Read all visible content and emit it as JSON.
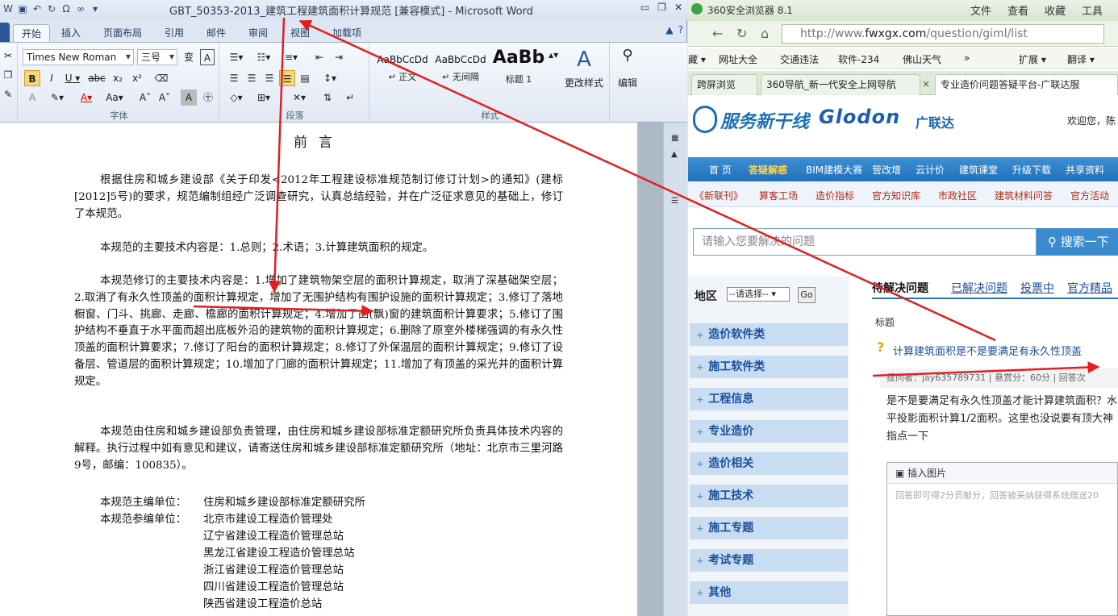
{
  "word": {
    "title": "GBT_50353-2013_建筑工程建筑面积计算规范 [兼容模式] - Microsoft Word",
    "qat_icons": [
      "word-icon",
      "save-icon",
      "undo-icon",
      "redo-icon",
      "symbol-icon",
      "customize-icon"
    ],
    "qat_omega": "Ω",
    "qat_infinity": "∞",
    "tabs": [
      "开始",
      "插入",
      "页面布局",
      "引用",
      "邮件",
      "审阅",
      "视图",
      "加载项"
    ],
    "font_name": "Times New Roman",
    "font_size": "三号",
    "styles": [
      {
        "sample": "AaBbCcDd",
        "name": "↵ 正文"
      },
      {
        "sample": "AaBbCcDd",
        "name": "↵ 无间隔"
      },
      {
        "sample": "AaBb",
        "name": "标题 1"
      }
    ],
    "change_styles": "更改样式",
    "edit": "编辑",
    "groups": [
      "字体",
      "段落",
      "样式"
    ],
    "doc": {
      "heading": "前言",
      "p1": "根据住房和城乡建设部《关于印发<2012年工程建设标准规范制订修订计划>的通知》(建标[2012]5号)的要求，规范编制组经广泛调查研究，认真总结经验，并在广泛征求意见的基础上，修订了本规范。",
      "p2": "本规范的主要技术内容是：1.总则；2.术语；3.计算建筑面积的规定。",
      "p3": "本规范修订的主要技术内容是：1.增加了建筑物架空层的面积计算规定，取消了深基础架空层；2.取消了有永久性顶盖的面积计算规定，增加了无围护结构有围护设施的面积计算规定；3.修订了落地橱窗、门斗、挑廊、走廊、檐廊的面积计算规定；4.增加了凸(飘)窗的建筑面积计算要求；5.修订了围护结构不垂直于水平面而超出底板外沿的建筑物的面积计算规定；6.删除了原室外楼梯强调的有永久性顶盖的面积计算要求；7.修订了阳台的面积计算规定；8.修订了外保温层的面积计算规定；9.修订了设备层、管道层的面积计算规定；10.增加了门廊的面积计算规定；11.增加了有顶盖的采光井的面积计算规定。",
      "p4": "本规范由住房和城乡建设部负责管理，由住房和城乡建设部标准定额研究所负责具体技术内容的解释。执行过程中如有意见和建议，请寄送住房和城乡建设部标准定额研究所（地址：北京市三里河路9号，邮编：100835）。",
      "chief_label": "本规范主编单位：",
      "chief": "住房和城乡建设部标准定额研究所",
      "part_label": "本规范参编单位：",
      "participants": [
        "北京市建设工程造价管理处",
        "辽宁省建设工程造价管理总站",
        "黑龙江省建设工程造价管理总站",
        "浙江省建设工程造价管理总站",
        "四川省建设工程造价管理总站",
        "陕西省建设工程造价总站"
      ]
    }
  },
  "browser": {
    "name": "360安全浏览器 8.1",
    "menu": [
      "文件",
      "查看",
      "收藏",
      "工具"
    ],
    "url_prefix": "http://www.",
    "url_domain": "fwxgx.com",
    "url_path": "/question/giml/list",
    "favorites": [
      "藏 ▾",
      "网址大全",
      "交通违法",
      "软件-234",
      "佛山天气",
      "»",
      "扩展 ▾",
      "翻译 ▾"
    ],
    "tabs": [
      "跨屏浏览",
      "360导航_新一代安全上网导航",
      "专业造价问题答疑平台-广联达服"
    ],
    "tab_close": "×"
  },
  "site": {
    "logo_text": "服务新干线",
    "brand": "Glodon",
    "brand_cn": "广联达",
    "welcome": "欢迎您，陈",
    "mainnav": [
      "首 页",
      "答疑解惑",
      "BIM建模大赛",
      "营改增",
      "云计价",
      "建筑课堂",
      "升级下载",
      "共享资料"
    ],
    "subnav": [
      "《新联刊》",
      "算客工场",
      "造价指标",
      "官方知识库",
      "市政社区",
      "建筑材料问答",
      "官方活动"
    ],
    "search_placeholder": "请输入您要解决的问题",
    "search_button": "搜索一下",
    "region_label": "地区",
    "region_select": "--请选择--",
    "go": "Go",
    "categories": [
      "造价软件类",
      "施工软件类",
      "工程信息",
      "专业造价",
      "造价相关",
      "施工技术",
      "施工专题",
      "考试专题",
      "其他"
    ],
    "qtabs": [
      "待解决问题",
      "已解决问题",
      "投票中",
      "官方精品"
    ],
    "col_title": "标题",
    "question_title": "计算建筑面积是不是要满足有永久性顶盖",
    "question_meta": "提问者：jay635789731  |  悬赏分：60分  |  回答次",
    "question_body": "是不是要满足有永久性顶盖才能计算建筑面积？水平投影面积计算1/2面积。这里也没说要有顶大神指点一下",
    "insert_image": "插入图片",
    "answer_placeholder": "回答即可得2分贡献分，回答被采纳获得系统赠送20"
  },
  "colors": {
    "arrow": "#e02020",
    "word_blue": "#2b579a",
    "site_blue": "#2170bb",
    "subnav_red": "#b12a1a"
  }
}
